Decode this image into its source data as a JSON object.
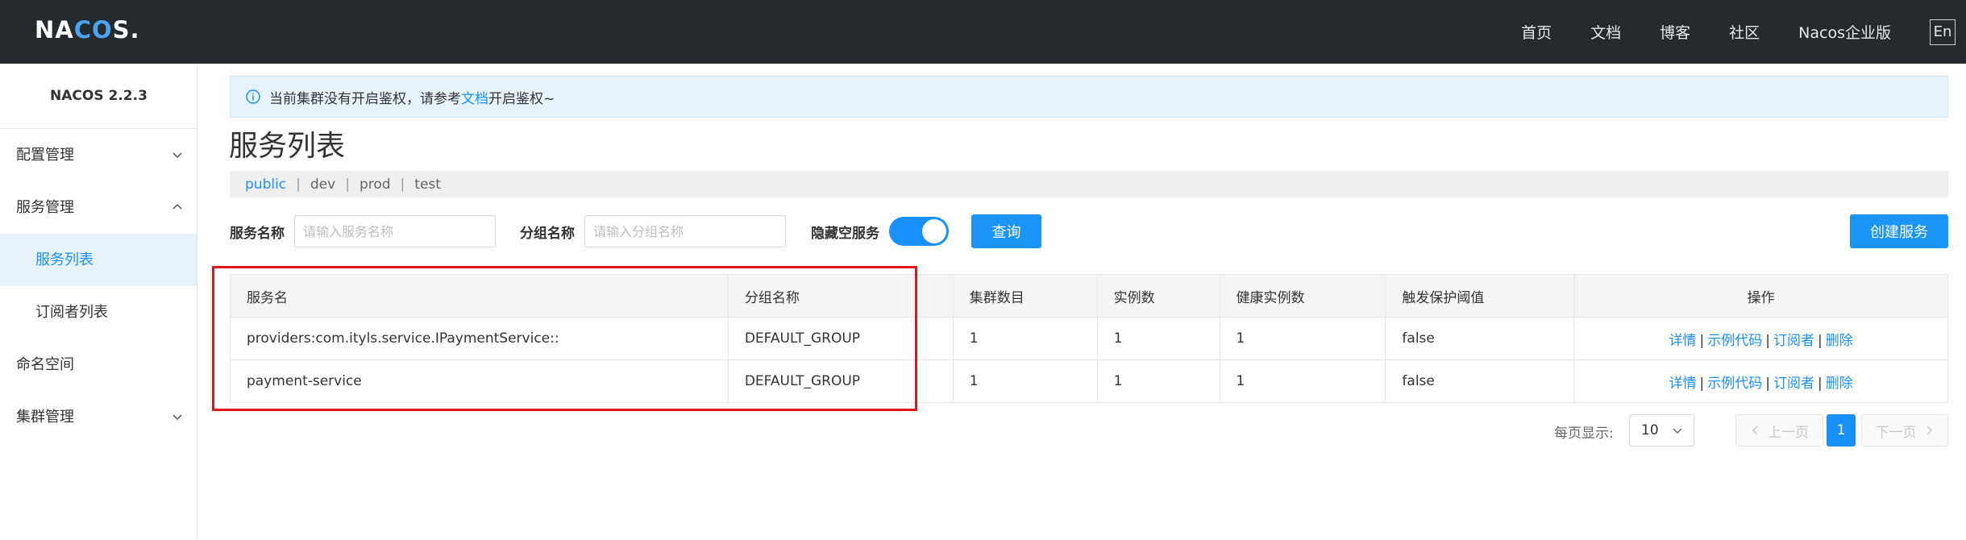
{
  "header": {
    "logo": {
      "pre": "NA",
      "co": "CO",
      "post": "S."
    },
    "nav": [
      "首页",
      "文档",
      "博客",
      "社区",
      "Nacos企业版"
    ],
    "lang_button": "En"
  },
  "sidebar": {
    "version": "NACOS 2.2.3",
    "items": [
      {
        "label": "配置管理",
        "expandable": true
      },
      {
        "label": "服务管理",
        "expandable": true
      },
      {
        "label": "服务列表",
        "sub": true,
        "active": true
      },
      {
        "label": "订阅者列表",
        "sub": true
      },
      {
        "label": "命名空间"
      },
      {
        "label": "集群管理",
        "expandable": true
      }
    ]
  },
  "notice": {
    "text_before": "当前集群没有开启鉴权，请参考",
    "link": "文档",
    "text_after": "开启鉴权~"
  },
  "page_title": "服务列表",
  "namespaces": [
    "public",
    "dev",
    "prod",
    "test"
  ],
  "filters": {
    "service_name_label": "服务名称",
    "service_name_placeholder": "请输入服务名称",
    "group_name_label": "分组名称",
    "group_name_placeholder": "请输入分组名称",
    "hide_empty_label": "隐藏空服务",
    "hide_empty_on": true,
    "query_button": "查询",
    "create_button": "创建服务"
  },
  "table": {
    "columns": [
      "服务名",
      "分组名称",
      "集群数目",
      "实例数",
      "健康实例数",
      "触发保护阈值",
      "操作"
    ],
    "rows": [
      {
        "service": "providers:com.ityls.service.IPaymentService::",
        "group": "DEFAULT_GROUP",
        "clusters": "1",
        "instances": "1",
        "healthy": "1",
        "threshold": "false"
      },
      {
        "service": "payment-service",
        "group": "DEFAULT_GROUP",
        "clusters": "1",
        "instances": "1",
        "healthy": "1",
        "threshold": "false"
      }
    ],
    "operations": [
      "详情",
      "示例代码",
      "订阅者",
      "删除"
    ]
  },
  "pagination": {
    "per_page_label": "每页显示:",
    "page_size": "10",
    "prev": "上一页",
    "next": "下一页",
    "current_page": "1"
  },
  "colors": {
    "accent": "#1890ff",
    "header_bg": "#252a2f",
    "highlight": "#e0161a"
  }
}
